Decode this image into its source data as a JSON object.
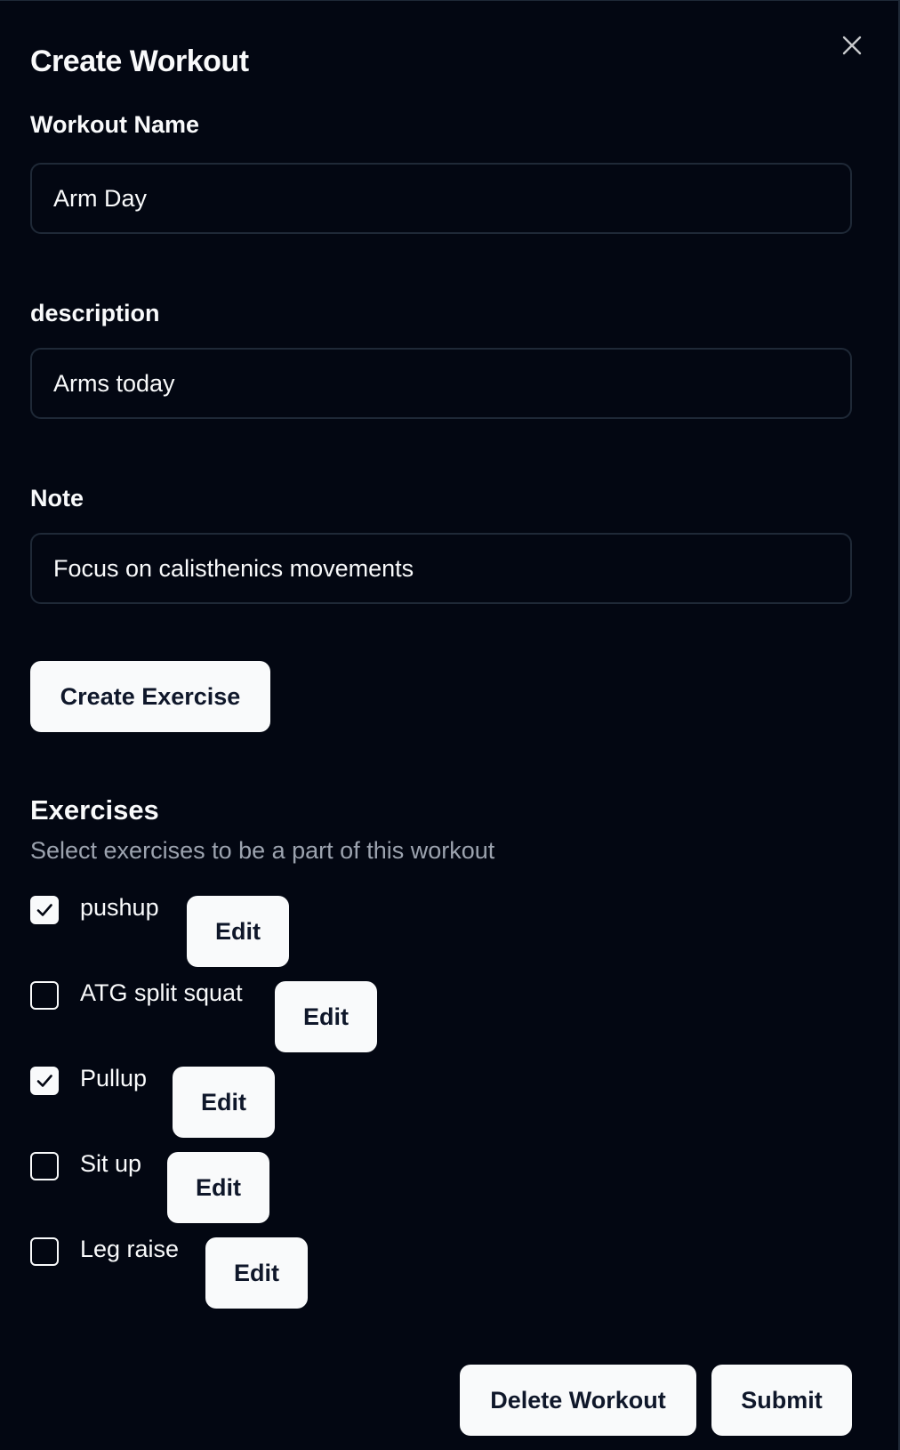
{
  "dialog": {
    "title": "Create Workout",
    "close_icon": "close-icon"
  },
  "form": {
    "workout_name": {
      "label": "Workout Name",
      "value": "Arm Day"
    },
    "description": {
      "label": "description",
      "value": "Arms today"
    },
    "note": {
      "label": "Note",
      "value": "Focus on calisthenics movements"
    },
    "create_exercise_label": "Create Exercise"
  },
  "exercises": {
    "title": "Exercises",
    "subtitle": "Select exercises to be a part of this workout",
    "items": [
      {
        "name": "pushup",
        "checked": true,
        "edit_label": "Edit"
      },
      {
        "name": "ATG split squat",
        "checked": false,
        "edit_label": "Edit"
      },
      {
        "name": "Pullup",
        "checked": true,
        "edit_label": "Edit"
      },
      {
        "name": "Sit up",
        "checked": false,
        "edit_label": "Edit"
      },
      {
        "name": "Leg raise",
        "checked": false,
        "edit_label": "Edit"
      }
    ]
  },
  "footer": {
    "delete_label": "Delete Workout",
    "submit_label": "Submit"
  },
  "colors": {
    "background": "#030712",
    "border": "#1f2937",
    "button_bg": "#f9fafb",
    "button_text": "#0f172a",
    "muted_text": "#9ca3af"
  }
}
